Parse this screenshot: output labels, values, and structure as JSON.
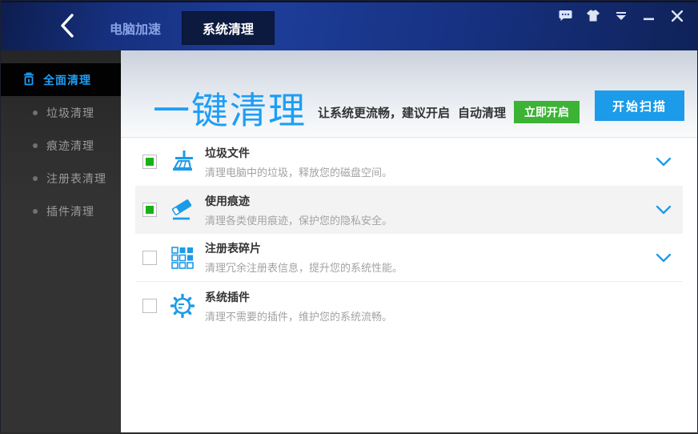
{
  "titlebar": {
    "tabs": [
      {
        "label": "电脑加速",
        "active": false
      },
      {
        "label": "系统清理",
        "active": true
      }
    ],
    "controls": {
      "feedback": "feedback-bubble",
      "skin": "skin-shirt",
      "menu": "main-menu-dropdown",
      "minimize": "minimize",
      "close": "close"
    }
  },
  "sidebar": {
    "items": [
      {
        "label": "全面清理",
        "active": true,
        "icon": "trash-icon"
      },
      {
        "label": "垃圾清理",
        "active": false
      },
      {
        "label": "痕迹清理",
        "active": false
      },
      {
        "label": "注册表清理",
        "active": false
      },
      {
        "label": "插件清理",
        "active": false
      }
    ]
  },
  "header": {
    "title": "一键清理",
    "subtitle": "让系统更流畅，建议开启",
    "highlight": "自动清理",
    "enable_button": "立即开启",
    "scan_button": "开始扫描"
  },
  "rows": [
    {
      "title": "垃圾文件",
      "desc": "清理电脑中的垃圾，释放您的磁盘空间。",
      "checked": true,
      "icon": "broom-icon",
      "expandable": true
    },
    {
      "title": "使用痕迹",
      "desc": "清理各类使用痕迹，保护您的隐私安全。",
      "checked": true,
      "icon": "eraser-icon",
      "expandable": true
    },
    {
      "title": "注册表碎片",
      "desc": "清理冗余注册表信息，提升您的系统性能。",
      "checked": false,
      "icon": "registry-grid-icon",
      "expandable": true
    },
    {
      "title": "系统插件",
      "desc": "清理不需要的插件，维护您的系统流畅。",
      "checked": false,
      "icon": "plugin-gear-icon",
      "expandable": false
    }
  ],
  "colors": {
    "accent_blue": "#1d9ef7",
    "button_blue": "#1b9be9",
    "green": "#3cb335",
    "checkbox_green": "#17b117",
    "titlebar_blue": "#1d3d99",
    "active_tab_bg": "#0c1a40",
    "sidebar_bg": "#333333",
    "sidebar_active_bg": "#020202",
    "row_alt_bg": "#f3f3f3"
  }
}
